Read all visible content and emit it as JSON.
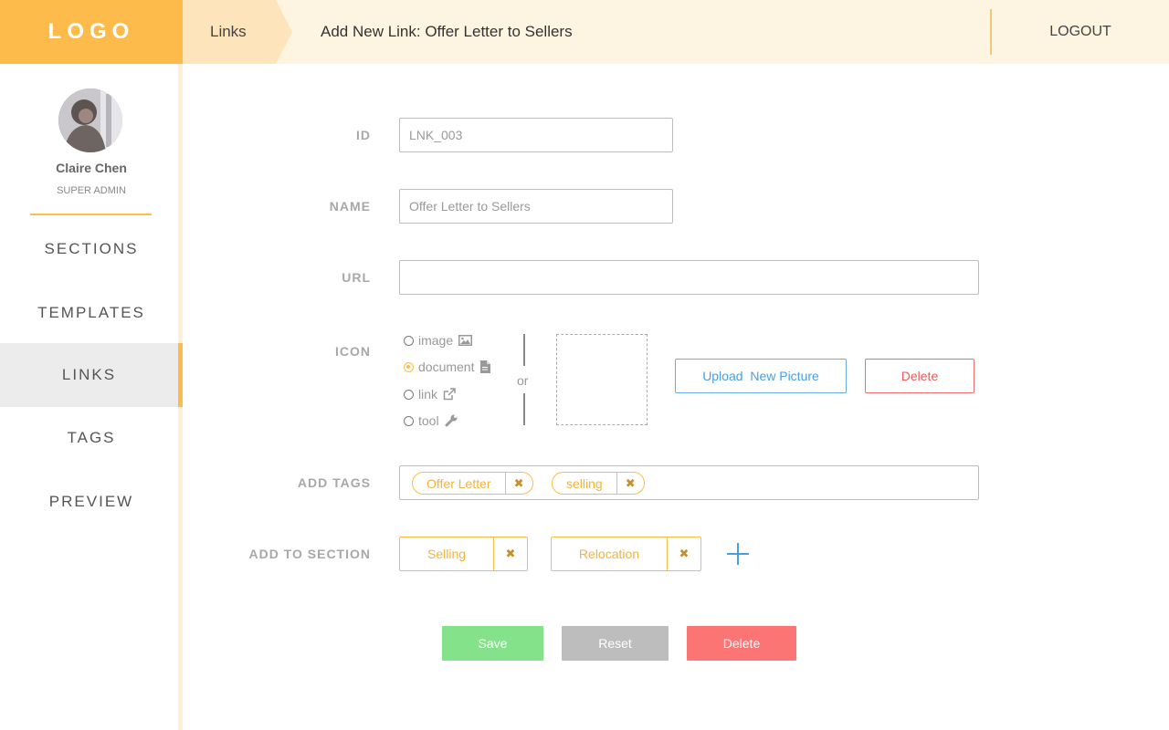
{
  "header": {
    "logo": "LOGO",
    "breadcrumb": "Links",
    "title": "Add New Link: Offer Letter to Sellers",
    "logout": "LOGOUT"
  },
  "sidebar": {
    "user": {
      "name": "Claire Chen",
      "role": "SUPER ADMIN"
    },
    "items": [
      {
        "label": "SECTIONS",
        "active": false
      },
      {
        "label": "TEMPLATES",
        "active": false
      },
      {
        "label": "LINKS",
        "active": true
      },
      {
        "label": "TAGS",
        "active": false
      },
      {
        "label": "PREVIEW",
        "active": false
      }
    ]
  },
  "form": {
    "id": {
      "label": "ID",
      "value": "LNK_003"
    },
    "name": {
      "label": "NAME",
      "value": "Offer Letter to Sellers"
    },
    "url": {
      "label": "URL",
      "value": ""
    },
    "icon": {
      "label": "ICON",
      "options": [
        {
          "label": "image",
          "icon": "image-icon",
          "selected": false
        },
        {
          "label": "document",
          "icon": "document-icon",
          "selected": true
        },
        {
          "label": "link",
          "icon": "external-link-icon",
          "selected": false
        },
        {
          "label": "tool",
          "icon": "wrench-icon",
          "selected": false
        }
      ],
      "or_text": "or",
      "upload_label": "Upload  New Picture",
      "delete_label": "Delete"
    },
    "tags": {
      "label": "ADD TAGS",
      "items": [
        "Offer Letter",
        "selling"
      ]
    },
    "sections": {
      "label": "ADD TO SECTION",
      "items": [
        "Selling",
        "Relocation"
      ]
    }
  },
  "actions": {
    "save": "Save",
    "reset": "Reset",
    "delete": "Delete"
  },
  "colors": {
    "accent": "#fdbb4b",
    "header_bg": "#fef4e2",
    "save": "#84e28b",
    "reset": "#bdbdbd",
    "delete": "#fb7575",
    "link_blue": "#4a9ee0"
  }
}
